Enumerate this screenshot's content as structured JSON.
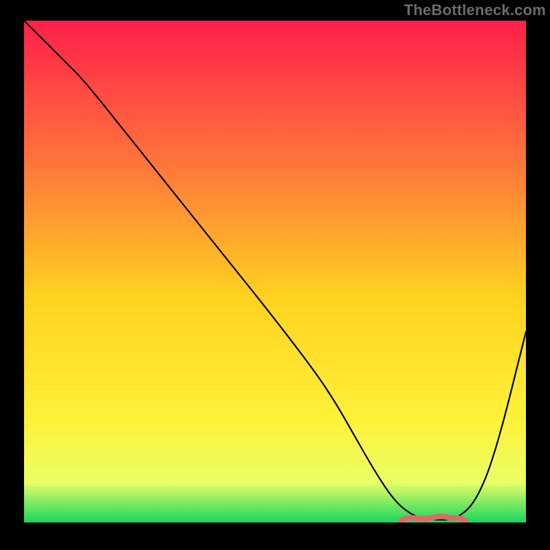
{
  "watermark": "TheBottleneck.com",
  "colors": {
    "gradient_top": "#ff1f4a",
    "gradient_mid1": "#ff7a3a",
    "gradient_mid2": "#ffd21f",
    "gradient_mid3": "#fff23a",
    "gradient_mid4": "#e9ff66",
    "gradient_bottom": "#18d65e",
    "line": "#000000",
    "bottom_accent": "#e06a6a"
  },
  "chart_data": {
    "type": "line",
    "title": "",
    "xlabel": "",
    "ylabel": "",
    "xlim": [
      0,
      100
    ],
    "ylim": [
      0,
      100
    ],
    "x": [
      0,
      4,
      8,
      12,
      20,
      30,
      40,
      50,
      58,
      62,
      66,
      70,
      74,
      78,
      82,
      86,
      90,
      94,
      100
    ],
    "values": [
      100,
      96,
      92,
      88,
      78,
      65.5,
      53,
      40.5,
      30,
      24,
      17,
      10,
      4,
      1,
      0.5,
      0.6,
      4,
      14,
      38
    ],
    "series": [
      {
        "name": "bottleneck-curve",
        "x": [
          0,
          4,
          8,
          12,
          20,
          30,
          40,
          50,
          58,
          62,
          66,
          70,
          74,
          78,
          82,
          86,
          90,
          94,
          100
        ],
        "values": [
          100,
          96,
          92,
          88,
          78,
          65.5,
          53,
          40.5,
          30,
          24,
          17,
          10,
          4,
          1,
          0.5,
          0.6,
          4,
          14,
          38
        ]
      }
    ],
    "bottom_segment": {
      "x_start": 75,
      "x_end": 88,
      "y": 0.6
    }
  }
}
